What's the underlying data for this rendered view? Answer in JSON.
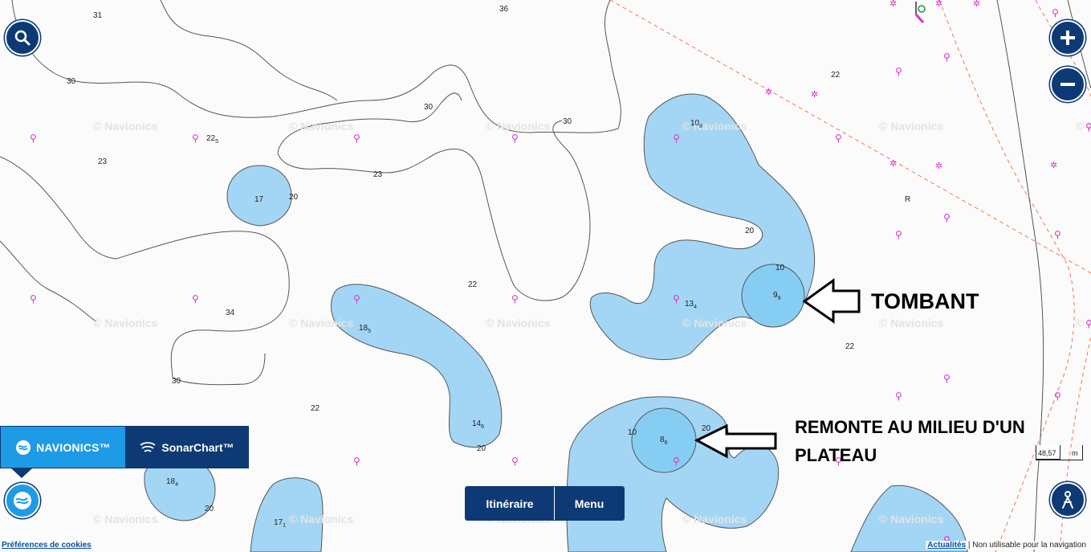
{
  "brand": {
    "navionics_label": "NAVIONICS™",
    "sonarchart_label": "SonarChart™"
  },
  "controls": {
    "search": "search-icon",
    "zoom_in": "plus-icon",
    "zoom_out": "minus-icon",
    "track": "person-location-icon",
    "layers": "navionics-logo-icon"
  },
  "bottom_menu": {
    "itinerary_label": "Itinéraire",
    "menu_label": "Menu"
  },
  "footer": {
    "cookies_label": "Préférences de cookies",
    "news_label": "Actualités",
    "separator": " | ",
    "disclaimer": "Non utilisable pour la navigation"
  },
  "scale": {
    "value": "48,57",
    "unit": "m"
  },
  "watermark": "© Navionics",
  "annotations": {
    "tombant": "TOMBANT",
    "plateau_line1": "REMONTE AU MILIEU D'UN",
    "plateau_line2": "PLATEAU"
  },
  "soundings": [
    {
      "main": "31",
      "sub": ""
    },
    {
      "main": "36",
      "sub": ""
    },
    {
      "main": "30",
      "sub": ""
    },
    {
      "main": "22",
      "sub": "5"
    },
    {
      "main": "23",
      "sub": ""
    },
    {
      "main": "30",
      "sub": ""
    },
    {
      "main": "30",
      "sub": ""
    },
    {
      "main": "23",
      "sub": ""
    },
    {
      "main": "17",
      "sub": ""
    },
    {
      "main": "20",
      "sub": ""
    },
    {
      "main": "10",
      "sub": "8"
    },
    {
      "main": "22",
      "sub": ""
    },
    {
      "main": "R",
      "sub": ""
    },
    {
      "main": "20",
      "sub": ""
    },
    {
      "main": "10",
      "sub": ""
    },
    {
      "main": "9",
      "sub": "9"
    },
    {
      "main": "13",
      "sub": "4"
    },
    {
      "main": "22",
      "sub": ""
    },
    {
      "main": "34",
      "sub": ""
    },
    {
      "main": "18",
      "sub": "5"
    },
    {
      "main": "22",
      "sub": ""
    },
    {
      "main": "30",
      "sub": ""
    },
    {
      "main": "22",
      "sub": ""
    },
    {
      "main": "14",
      "sub": "6"
    },
    {
      "main": "20",
      "sub": ""
    },
    {
      "main": "10",
      "sub": ""
    },
    {
      "main": "8",
      "sub": "6"
    },
    {
      "main": "20",
      "sub": ""
    },
    {
      "main": "18",
      "sub": "4"
    },
    {
      "main": "20",
      "sub": ""
    },
    {
      "main": "17",
      "sub": "1"
    }
  ],
  "colors": {
    "shallow_fill": "#a3d6f5",
    "very_shallow_fill": "#86cdf3",
    "land_bg": "#fbfbfb",
    "contour": "#555555",
    "boundary_line": "#ee7a55",
    "buoy": "#d433c8",
    "ui_dark": "#0d3a75",
    "ui_light": "#1e9be6"
  }
}
